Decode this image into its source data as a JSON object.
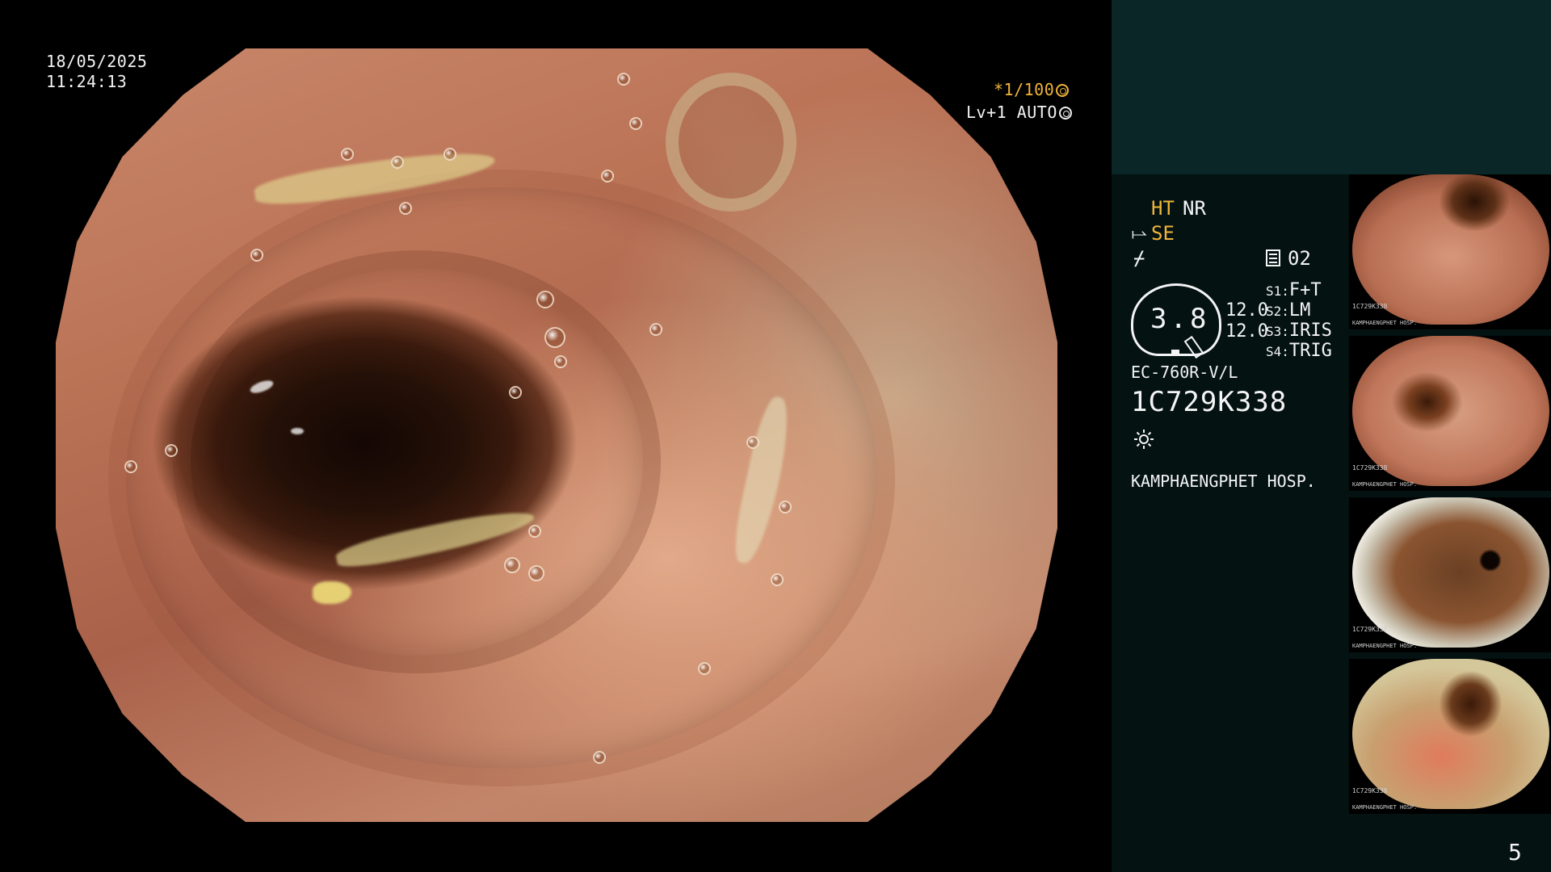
{
  "overlay": {
    "date": "18/05/2025",
    "time": "11:24:13",
    "shutter": "*1/100",
    "level": "Lv+1 AUTO"
  },
  "panel": {
    "ht": "HT",
    "nr": "NR",
    "se_symbol": "⥛",
    "se": "SE",
    "f_symbol": "⌿",
    "memory": "02",
    "dial_value": "3.8",
    "values": [
      "12.0",
      "12.0"
    ],
    "switches": [
      {
        "key": "S1:",
        "value": "F+T"
      },
      {
        "key": "S2:",
        "value": "LM"
      },
      {
        "key": "S3:",
        "value": "IRIS"
      },
      {
        "key": "S4:",
        "value": "TRIG"
      }
    ],
    "scope_model": "EC-760R-V/L",
    "serial": "1C729K338",
    "hospital": "KAMPHAENGPHET HOSP.",
    "page_number": "5"
  },
  "thumbnails": [
    {
      "serial": "1C729K338",
      "hospital": "KAMPHAENGPHET HOSP."
    },
    {
      "serial": "1C729K338",
      "hospital": "KAMPHAENGPHET HOSP."
    },
    {
      "serial": "1C729K338",
      "hospital": "KAMPHAENGPHET HOSP."
    },
    {
      "serial": "1C729K338",
      "hospital": "KAMPHAENGPHET HOSP."
    }
  ],
  "colors": {
    "accent": "#f0b43a",
    "panel_bg": "#041212",
    "panel_top": "#0b2626",
    "text": "#f4f4f4"
  }
}
